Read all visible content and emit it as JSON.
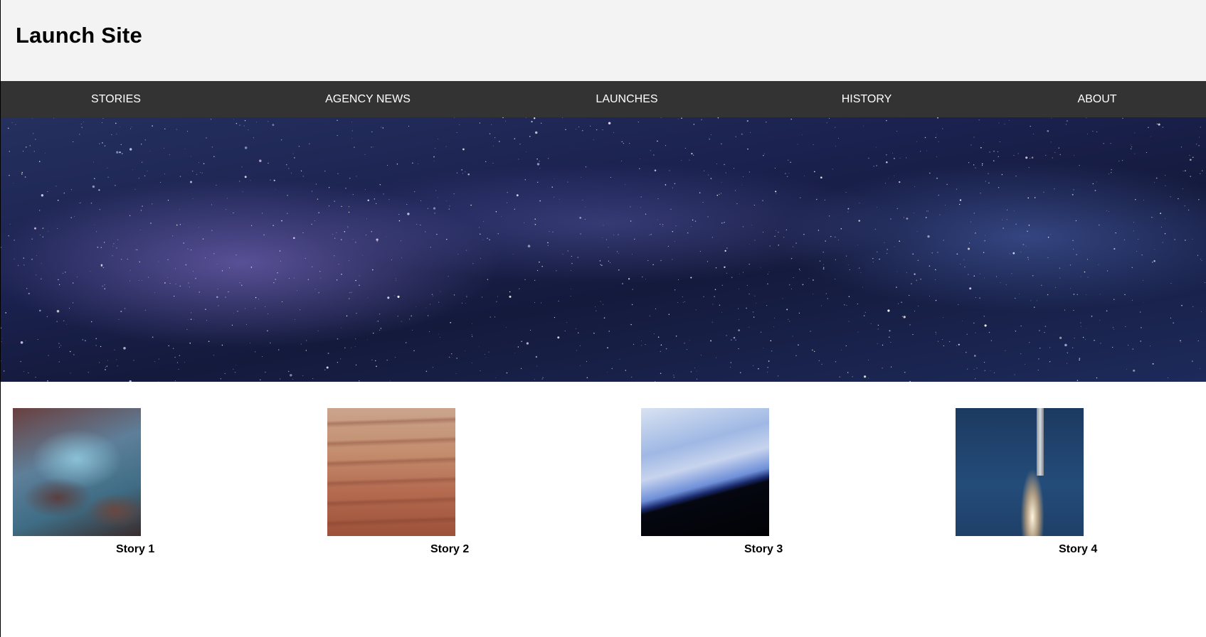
{
  "site": {
    "title": "Launch Site"
  },
  "nav": {
    "items": [
      {
        "label": "STORIES"
      },
      {
        "label": "AGENCY NEWS"
      },
      {
        "label": "LAUNCHES"
      },
      {
        "label": "HISTORY"
      },
      {
        "label": "ABOUT"
      }
    ]
  },
  "stories": [
    {
      "caption": "Story 1",
      "image": "nebula-image"
    },
    {
      "caption": "Story 2",
      "image": "desert-landscape-image"
    },
    {
      "caption": "Story 3",
      "image": "earth-horizon-image"
    },
    {
      "caption": "Story 4",
      "image": "rocket-launch-image"
    }
  ],
  "colors": {
    "header_bg": "#f3f3f3",
    "nav_bg": "#333333",
    "nav_text": "#ffffff",
    "page_bg": "#ffffff"
  }
}
